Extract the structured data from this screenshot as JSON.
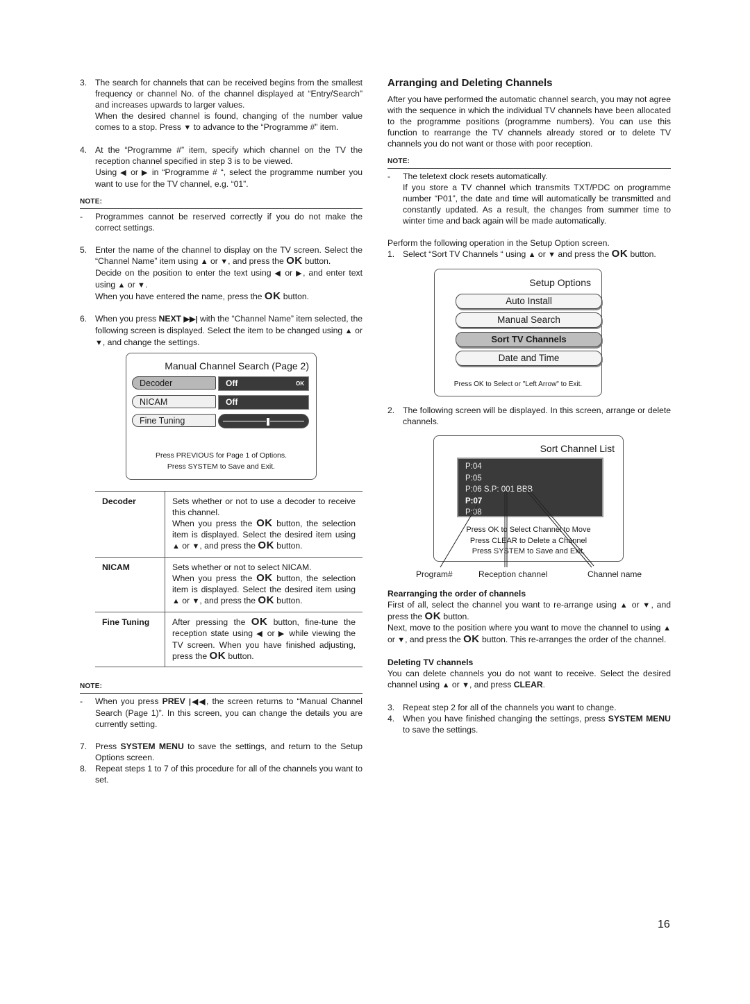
{
  "page_number": "16",
  "icons": {
    "up": "▲",
    "down": "▼",
    "left": "◀",
    "right": "▶",
    "next": "▶▶|",
    "prev": "|◀◀",
    "ok": "OK"
  },
  "left": {
    "step3": {
      "num": "3.",
      "p1": "The search for channels that can be received begins from the smallest frequency or channel No. of the channel displayed at “Entry/Search” and increases upwards to larger values.",
      "p2a": "When the desired channel is found, changing of the number value comes to a stop. Press ",
      "p2b": " to advance to the “Programme #” item."
    },
    "step4": {
      "num": "4.",
      "p1": "At the “Programme #” item, specify which channel on the TV the reception channel specified in step 3 is to be viewed.",
      "p2a": "Using ",
      "p2b": " or ",
      "p2c": " in “Programme # “, select the programme number you want to use for the TV channel, e.g. “01”."
    },
    "note1": {
      "heading": "NOTE:",
      "dash": "-",
      "text": "Programmes cannot be reserved correctly if you do not make the correct settings."
    },
    "step5": {
      "num": "5.",
      "a": "Enter the name of the channel to display on the TV screen. Select the “Channel Name” item using ",
      "b": " or ",
      "c": ", and press the ",
      "d": " button.",
      "e": "Decide on the position to enter the text using ",
      "f": " or ",
      "g": ", and enter text using ",
      "h": " or ",
      "i": ".",
      "j": "When you have entered the name, press the ",
      "k": " button."
    },
    "step6": {
      "num": "6.",
      "a": "When you press ",
      "next_label": "NEXT",
      "b": " with the “Channel Name” item selected, the following screen is displayed. Select the item to be changed using ",
      "c": " or ",
      "d": ", and change the settings."
    },
    "manual_search_screen": {
      "title": "Manual Channel Search  (Page 2)",
      "rows": [
        {
          "label": "Decoder",
          "value": "Off",
          "mark": "OK"
        },
        {
          "label": "NICAM",
          "value": "Off"
        },
        {
          "label": "Fine Tuning",
          "slider_value": 0.55
        }
      ],
      "footer1": "Press PREVIOUS for Page 1 of Options.",
      "footer2": "Press SYSTEM to Save and Exit."
    },
    "table": [
      {
        "key": "Decoder",
        "l1": "Sets whether or not to use a decoder to receive this channel.",
        "l2a": "When you press the ",
        "l2b": " button, the selection item is displayed. Select the desired item using ",
        "l2c": " or ",
        "l2d": ", and press the ",
        "l2e": " button."
      },
      {
        "key": "NICAM",
        "l1": "Sets whether or not to select NICAM.",
        "l2a": "When you press the ",
        "l2b": " button, the selection item is displayed. Select the desired item using ",
        "l2c": " or ",
        "l2d": ", and press the ",
        "l2e": " button."
      },
      {
        "key": "Fine Tuning",
        "a": "After pressing the ",
        "b": " button, fine-tune the reception state using ",
        "c": " or ",
        "d": " while viewing the TV screen. When you have finished adjusting, press the ",
        "e": " button."
      }
    ],
    "note2": {
      "heading": "NOTE:",
      "dash": "-",
      "a": "When you press ",
      "prev_label": "PREV",
      "b": ", the screen returns to “Manual Channel Search (Page 1)”. In this screen, you can change the details you are currently setting."
    },
    "step7": {
      "num": "7.",
      "a": "Press ",
      "bold": "SYSTEM MENU",
      "b": " to save the settings, and return to the Setup Options screen."
    },
    "step8": {
      "num": "8.",
      "text": "Repeat steps 1 to 7 of this procedure for all of the channels you want to set."
    }
  },
  "right": {
    "heading": "Arranging and Deleting Channels",
    "intro": "After you have performed the automatic channel search, you may not agree with the sequence in which the individual TV channels have been allocated to the programme positions (programme numbers). You can use this function to rearrange the TV channels already stored or to delete TV channels you do not want or those with poor reception.",
    "note": {
      "heading": "NOTE:",
      "dash": "-",
      "l1": "The teletext clock resets automatically.",
      "l2": "If you store a TV channel which transmits TXT/PDC on programme number “P01”, the date and time will automatically be transmitted and constantly updated. As a result, the changes from summer time to winter time and back again will be made automatically."
    },
    "perform": "Perform the following operation in the Setup Option screen.",
    "step1": {
      "num": "1.",
      "a": "Select “Sort TV Channels “ using ",
      "b": " or ",
      "c": " and press the ",
      "d": " button."
    },
    "setup_screen": {
      "title": "Setup Options",
      "buttons": [
        {
          "label": "Auto Install",
          "selected": false
        },
        {
          "label": "Manual Search",
          "selected": false
        },
        {
          "label": "Sort TV Channels",
          "selected": true
        },
        {
          "label": "Date and Time",
          "selected": false
        }
      ],
      "footer": "Press OK to Select or \"Left Arrow\" to Exit."
    },
    "step2": {
      "num": "2.",
      "text": "The following screen will be displayed. In this screen, arrange or delete channels."
    },
    "sort_screen": {
      "title": "Sort Channel List",
      "items": [
        {
          "text": "P:04",
          "bold": false
        },
        {
          "text": "P:05",
          "bold": false
        },
        {
          "text": "P:06 S.P: 001 BBB",
          "bold": false
        },
        {
          "text": "P:07",
          "bold": true
        },
        {
          "text": "P:08",
          "bold": false
        }
      ],
      "footer1": "Press OK to Select Channel to Move",
      "footer2": "Press CLEAR to Delete a Channel",
      "footer3": "Press SYSTEM to Save and Exit."
    },
    "callouts": {
      "program": "Program#",
      "reception": "Reception channel",
      "name": "Channel name"
    },
    "rearrange": {
      "heading": "Rearranging the order of channels",
      "a": "First of all, select the channel you want to re-arrange using ",
      "b": " or ",
      "c": ", and press the ",
      "d": " button.",
      "e": "Next, move to the position where you want to move the channel to using ",
      "f": " or ",
      "g": ", and press the ",
      "h": " button. This re-arranges the order of the channel."
    },
    "delete": {
      "heading": "Deleting TV channels",
      "a": "You can delete channels you do not want to receive. Select the desired channel using ",
      "b": " or ",
      "c": ", and press ",
      "bold": "CLEAR",
      "d": "."
    },
    "step3": {
      "num": "3.",
      "text": "Repeat step 2 for all of the channels you want to change."
    },
    "step4": {
      "num": "4.",
      "a": "When you have finished changing the settings, press ",
      "bold": "SYSTEM MENU",
      "b": " to save the settings."
    }
  }
}
